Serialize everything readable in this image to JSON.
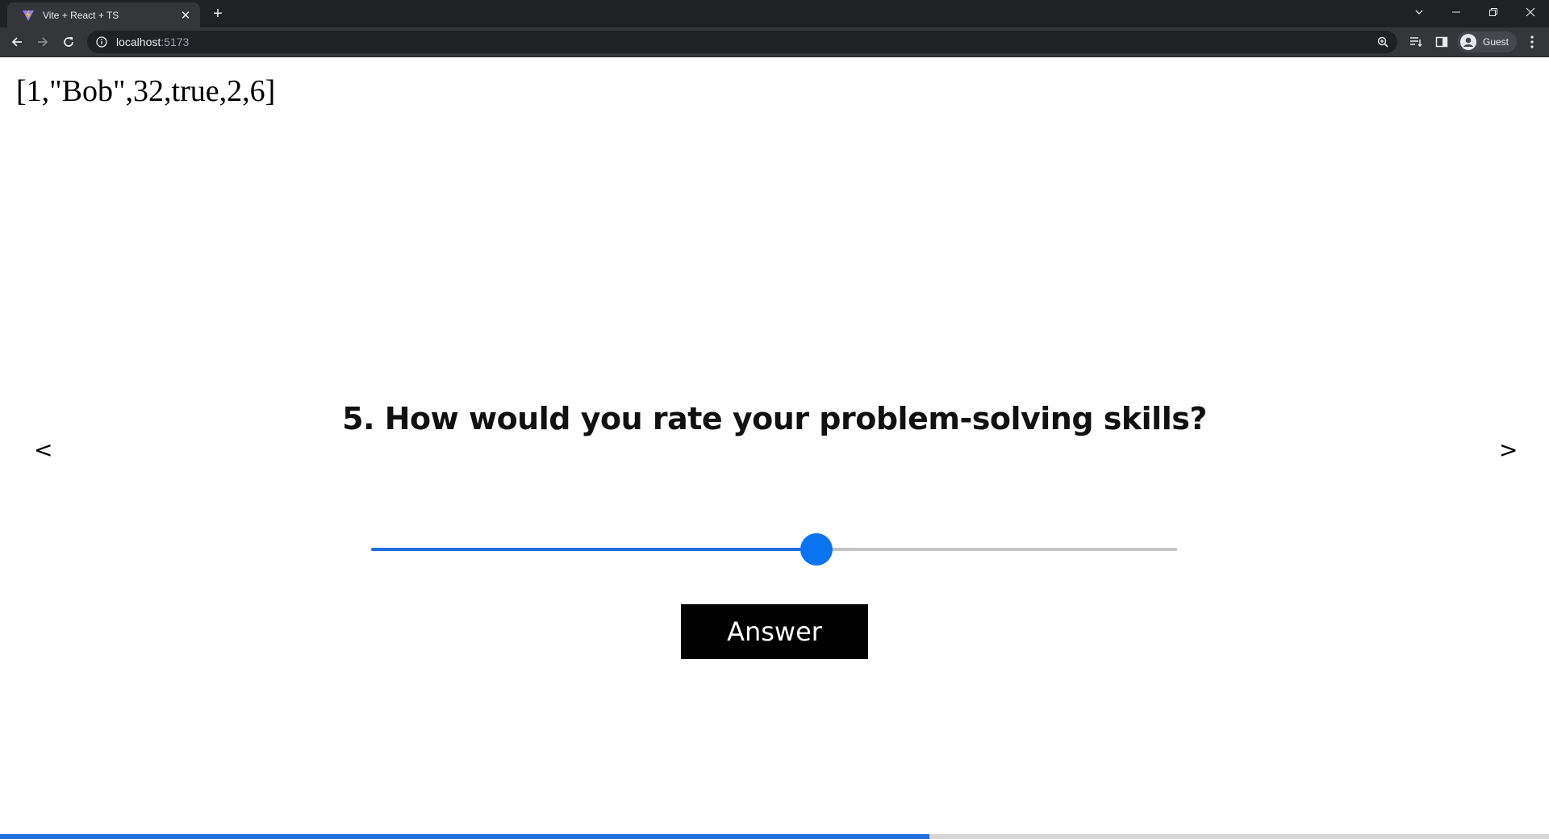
{
  "browser": {
    "tab_title": "Vite + React + TS",
    "url_host": "localhost",
    "url_port": ":5173",
    "profile_name": "Guest"
  },
  "page": {
    "state_dump": "[1,\"Bob\",32,true,2,6]",
    "question": "5. How would you rate your problem-solving skills?",
    "prev_label": "<",
    "next_label": ">",
    "answer_label": "Answer",
    "slider_value_fraction": 0.553,
    "progress_fraction": 0.6
  },
  "colors": {
    "accent": "#1e6fdc",
    "slider_thumb": "#0a74f0",
    "button_bg": "#000000"
  }
}
